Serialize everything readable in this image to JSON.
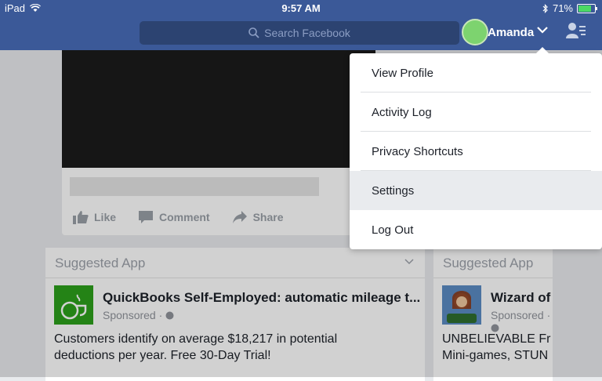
{
  "status_bar": {
    "device": "iPad",
    "time": "9:57 AM",
    "battery": "71%",
    "battery_level": 0.71
  },
  "nav": {
    "search_placeholder": "Search Facebook",
    "user_name": "Amanda"
  },
  "post": {
    "actions": [
      "Like",
      "Comment",
      "Share"
    ]
  },
  "suggested": [
    {
      "header": "Suggested App",
      "title": "QuickBooks Self-Employed: automatic mileage t...",
      "sponsored": "Sponsored ·",
      "text": "Customers identify on average $18,217 in potential\ndeductions per year. Free 30-Day Trial!"
    },
    {
      "header": "Suggested App",
      "title": "Wizard of",
      "sponsored": "Sponsored ·",
      "text": "UNBELIEVABLE Fr\nMini-games, STUN"
    }
  ],
  "menu": {
    "items": [
      "View Profile",
      "Activity Log",
      "Privacy Shortcuts",
      "Settings",
      "Log Out"
    ],
    "highlighted": "Settings"
  },
  "colors": {
    "nav_bg": "#3b5998",
    "menu_highlight": "#e9ebee"
  }
}
